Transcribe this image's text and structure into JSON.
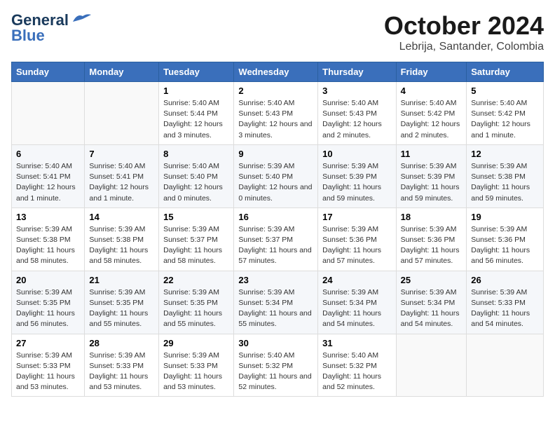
{
  "header": {
    "logo_line1": "General",
    "logo_line2": "Blue",
    "month": "October 2024",
    "location": "Lebrija, Santander, Colombia"
  },
  "days_of_week": [
    "Sunday",
    "Monday",
    "Tuesday",
    "Wednesday",
    "Thursday",
    "Friday",
    "Saturday"
  ],
  "weeks": [
    [
      {
        "day": "",
        "info": ""
      },
      {
        "day": "",
        "info": ""
      },
      {
        "day": "1",
        "info": "Sunrise: 5:40 AM\nSunset: 5:44 PM\nDaylight: 12 hours and 3 minutes."
      },
      {
        "day": "2",
        "info": "Sunrise: 5:40 AM\nSunset: 5:43 PM\nDaylight: 12 hours and 3 minutes."
      },
      {
        "day": "3",
        "info": "Sunrise: 5:40 AM\nSunset: 5:43 PM\nDaylight: 12 hours and 2 minutes."
      },
      {
        "day": "4",
        "info": "Sunrise: 5:40 AM\nSunset: 5:42 PM\nDaylight: 12 hours and 2 minutes."
      },
      {
        "day": "5",
        "info": "Sunrise: 5:40 AM\nSunset: 5:42 PM\nDaylight: 12 hours and 1 minute."
      }
    ],
    [
      {
        "day": "6",
        "info": "Sunrise: 5:40 AM\nSunset: 5:41 PM\nDaylight: 12 hours and 1 minute."
      },
      {
        "day": "7",
        "info": "Sunrise: 5:40 AM\nSunset: 5:41 PM\nDaylight: 12 hours and 1 minute."
      },
      {
        "day": "8",
        "info": "Sunrise: 5:40 AM\nSunset: 5:40 PM\nDaylight: 12 hours and 0 minutes."
      },
      {
        "day": "9",
        "info": "Sunrise: 5:39 AM\nSunset: 5:40 PM\nDaylight: 12 hours and 0 minutes."
      },
      {
        "day": "10",
        "info": "Sunrise: 5:39 AM\nSunset: 5:39 PM\nDaylight: 11 hours and 59 minutes."
      },
      {
        "day": "11",
        "info": "Sunrise: 5:39 AM\nSunset: 5:39 PM\nDaylight: 11 hours and 59 minutes."
      },
      {
        "day": "12",
        "info": "Sunrise: 5:39 AM\nSunset: 5:38 PM\nDaylight: 11 hours and 59 minutes."
      }
    ],
    [
      {
        "day": "13",
        "info": "Sunrise: 5:39 AM\nSunset: 5:38 PM\nDaylight: 11 hours and 58 minutes."
      },
      {
        "day": "14",
        "info": "Sunrise: 5:39 AM\nSunset: 5:38 PM\nDaylight: 11 hours and 58 minutes."
      },
      {
        "day": "15",
        "info": "Sunrise: 5:39 AM\nSunset: 5:37 PM\nDaylight: 11 hours and 58 minutes."
      },
      {
        "day": "16",
        "info": "Sunrise: 5:39 AM\nSunset: 5:37 PM\nDaylight: 11 hours and 57 minutes."
      },
      {
        "day": "17",
        "info": "Sunrise: 5:39 AM\nSunset: 5:36 PM\nDaylight: 11 hours and 57 minutes."
      },
      {
        "day": "18",
        "info": "Sunrise: 5:39 AM\nSunset: 5:36 PM\nDaylight: 11 hours and 57 minutes."
      },
      {
        "day": "19",
        "info": "Sunrise: 5:39 AM\nSunset: 5:36 PM\nDaylight: 11 hours and 56 minutes."
      }
    ],
    [
      {
        "day": "20",
        "info": "Sunrise: 5:39 AM\nSunset: 5:35 PM\nDaylight: 11 hours and 56 minutes."
      },
      {
        "day": "21",
        "info": "Sunrise: 5:39 AM\nSunset: 5:35 PM\nDaylight: 11 hours and 55 minutes."
      },
      {
        "day": "22",
        "info": "Sunrise: 5:39 AM\nSunset: 5:35 PM\nDaylight: 11 hours and 55 minutes."
      },
      {
        "day": "23",
        "info": "Sunrise: 5:39 AM\nSunset: 5:34 PM\nDaylight: 11 hours and 55 minutes."
      },
      {
        "day": "24",
        "info": "Sunrise: 5:39 AM\nSunset: 5:34 PM\nDaylight: 11 hours and 54 minutes."
      },
      {
        "day": "25",
        "info": "Sunrise: 5:39 AM\nSunset: 5:34 PM\nDaylight: 11 hours and 54 minutes."
      },
      {
        "day": "26",
        "info": "Sunrise: 5:39 AM\nSunset: 5:33 PM\nDaylight: 11 hours and 54 minutes."
      }
    ],
    [
      {
        "day": "27",
        "info": "Sunrise: 5:39 AM\nSunset: 5:33 PM\nDaylight: 11 hours and 53 minutes."
      },
      {
        "day": "28",
        "info": "Sunrise: 5:39 AM\nSunset: 5:33 PM\nDaylight: 11 hours and 53 minutes."
      },
      {
        "day": "29",
        "info": "Sunrise: 5:39 AM\nSunset: 5:33 PM\nDaylight: 11 hours and 53 minutes."
      },
      {
        "day": "30",
        "info": "Sunrise: 5:40 AM\nSunset: 5:32 PM\nDaylight: 11 hours and 52 minutes."
      },
      {
        "day": "31",
        "info": "Sunrise: 5:40 AM\nSunset: 5:32 PM\nDaylight: 11 hours and 52 minutes."
      },
      {
        "day": "",
        "info": ""
      },
      {
        "day": "",
        "info": ""
      }
    ]
  ]
}
